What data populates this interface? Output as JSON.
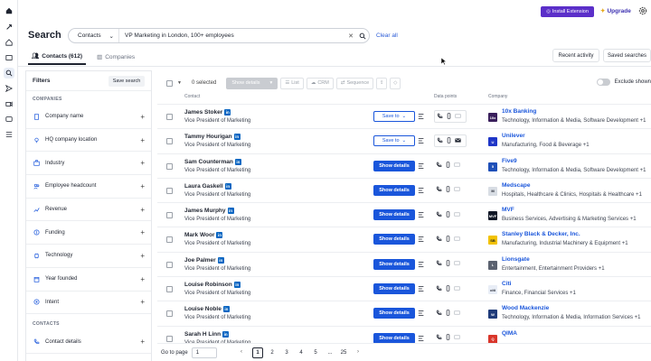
{
  "topbar": {
    "install_label": "Install Extension",
    "upgrade_label": "Upgrade"
  },
  "header": {
    "title": "Search",
    "scope": "Contacts",
    "query": "VP Marketing in London, 100+ employees",
    "clear_label": "Clear all"
  },
  "tabs": [
    {
      "label": "Contacts (612)"
    },
    {
      "label": "Companies"
    }
  ],
  "actions": {
    "recent": "Recent activity",
    "saved": "Saved searches"
  },
  "filters": {
    "title": "Filters",
    "save_label": "Save search",
    "companies_label": "COMPANIES",
    "contacts_label": "CONTACTS",
    "company_items": [
      {
        "label": "Company name",
        "icon": "building-icon"
      },
      {
        "label": "HQ company location",
        "icon": "location-icon"
      },
      {
        "label": "Industry",
        "icon": "briefcase-icon"
      },
      {
        "label": "Employee headcount",
        "icon": "people-icon"
      },
      {
        "label": "Revenue",
        "icon": "trend-icon"
      },
      {
        "label": "Funding",
        "icon": "coin-icon"
      },
      {
        "label": "Technology",
        "icon": "chip-icon"
      },
      {
        "label": "Year founded",
        "icon": "calendar-icon"
      },
      {
        "label": "Intent",
        "icon": "target-icon"
      }
    ],
    "contact_items": [
      {
        "label": "Contact details",
        "icon": "phone-icon"
      }
    ]
  },
  "results": {
    "selected": "0 selected",
    "show_details": "Show details",
    "list": "List",
    "crm": "CRM",
    "sequence": "Sequence",
    "exclude_label": "Exclude shown",
    "col_contact": "Contact",
    "col_datapoints": "Data points",
    "col_company": "Company",
    "save_to": "Save to",
    "rows": [
      {
        "name": "James Stoker",
        "title": "Vice President of Marketing",
        "action": "save",
        "company": "10x Banking",
        "industry": "Technology, Information & Media, Software Development +1",
        "logo_color": "#3a1f5c",
        "logo_text": "10x"
      },
      {
        "name": "Tammy Hourigan",
        "title": "Vice President of Marketing",
        "action": "save",
        "company": "Unilever",
        "industry": "Manufacturing, Food & Beverage +1",
        "logo_color": "#1f36c7",
        "logo_text": "U"
      },
      {
        "name": "Sam Counterman",
        "title": "Vice President of Marketing",
        "action": "show",
        "company": "Five9",
        "industry": "Technology, Information & Media, Software Development +1",
        "logo_color": "#1e4fb8",
        "logo_text": "5"
      },
      {
        "name": "Laura Gaskell",
        "title": "Vice President of Marketing",
        "action": "show",
        "company": "Medscape",
        "industry": "Hospitals, Healthcare & Clinics, Hospitals & Healthcare +1",
        "logo_color": "#d8dde4",
        "logo_text": "M"
      },
      {
        "name": "James Murphy",
        "title": "Vice President of Marketing",
        "action": "show",
        "company": "MVF",
        "industry": "Business Services, Advertising & Marketing Services +1",
        "logo_color": "#111827",
        "logo_text": "MVF"
      },
      {
        "name": "Mark Woor",
        "title": "Vice President of Marketing",
        "action": "show",
        "company": "Stanley Black & Decker, Inc.",
        "industry": "Manufacturing, Industrial Machinery & Equipment +1",
        "logo_color": "#f2c200",
        "logo_text": "SB"
      },
      {
        "name": "Joe Palmer",
        "title": "Vice President of Marketing",
        "action": "show",
        "company": "Lionsgate",
        "industry": "Entertainment, Entertainment Providers +1",
        "logo_color": "#5b6270",
        "logo_text": "L"
      },
      {
        "name": "Louise Robinson",
        "title": "Vice President of Marketing",
        "action": "show",
        "company": "Citi",
        "industry": "Finance, Financial Services +1",
        "logo_color": "#e8edf6",
        "logo_text": "citi"
      },
      {
        "name": "Louise Noble",
        "title": "Vice President of Marketing",
        "action": "show",
        "company": "Wood Mackenzie",
        "industry": "Technology, Information & Media, Information Services +1",
        "logo_color": "#1f3b7a",
        "logo_text": "W"
      },
      {
        "name": "Sarah H Linn",
        "title": "Vice President of Marketing",
        "action": "show",
        "company": "QIMA",
        "industry": "",
        "logo_color": "#d9362b",
        "logo_text": "Q"
      }
    ]
  },
  "pager": {
    "goto_label": "Go to page",
    "input_value": "1",
    "pages": [
      "1",
      "2",
      "3",
      "4",
      "5",
      "...",
      "25"
    ]
  }
}
